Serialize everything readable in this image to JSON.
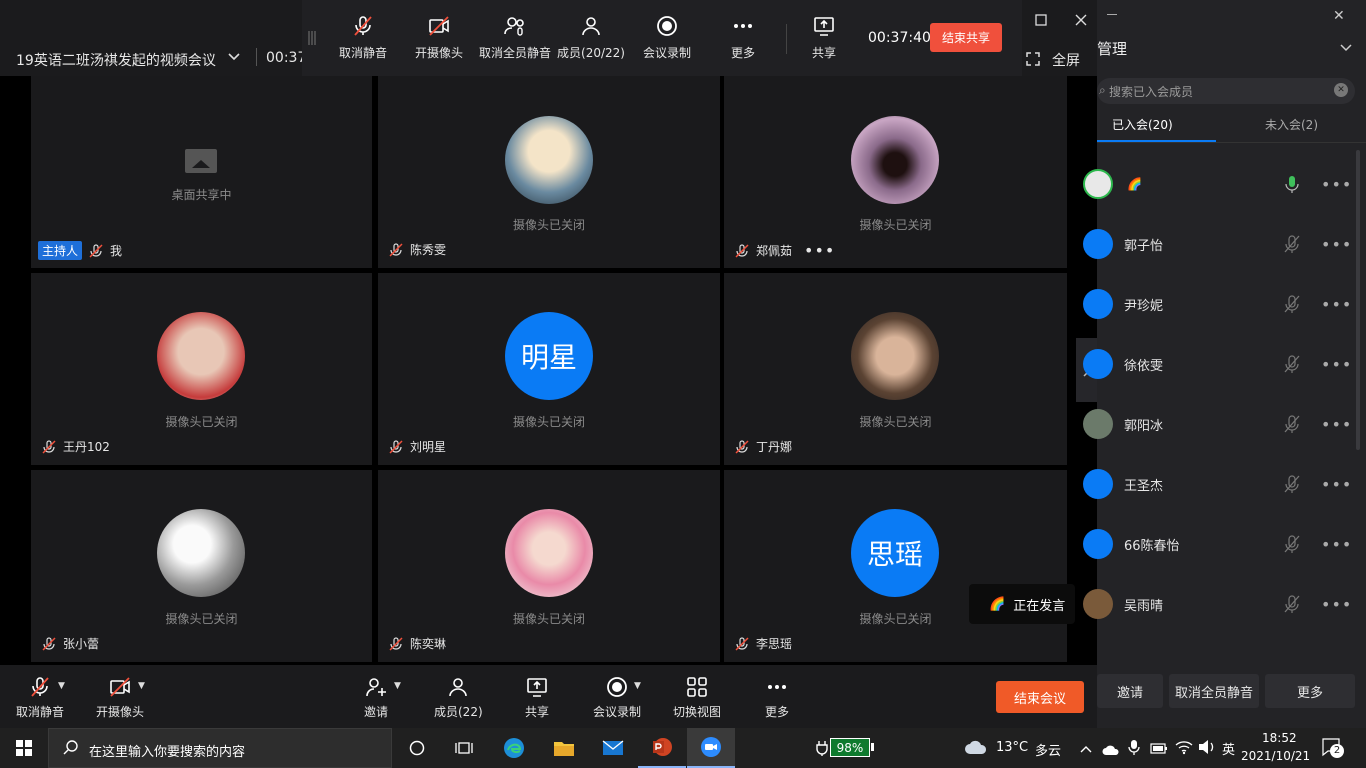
{
  "meeting": {
    "title": "19英语二班汤祺发起的视频会议",
    "elapsed_partial": "00:37.",
    "fullscreen_label": "全屏"
  },
  "top_toolbar": {
    "unmute": "取消静音",
    "camera_on": "开摄像头",
    "unmute_all": "取消全员静音",
    "members": "成员(20/22)",
    "record": "会议录制",
    "more": "更多",
    "share": "共享",
    "timer": "00:37:40",
    "end_share": "结束共享"
  },
  "tiles": [
    {
      "name": "我",
      "host": "主持人",
      "status": "桌面共享中"
    },
    {
      "name": "陈秀雯",
      "status": "摄像头已关闭"
    },
    {
      "name": "郑佩茹",
      "status": "摄像头已关闭"
    },
    {
      "name": "王丹102",
      "status": "摄像头已关闭"
    },
    {
      "name": "刘明星",
      "status": "摄像头已关闭",
      "avatar_text": "明星"
    },
    {
      "name": "丁丹娜",
      "status": "摄像头已关闭"
    },
    {
      "name": "张小蕾",
      "status": "摄像头已关闭"
    },
    {
      "name": "陈奕琳",
      "status": "摄像头已关闭"
    },
    {
      "name": "李思瑶",
      "status": "摄像头已关闭",
      "avatar_text": "思瑶"
    }
  ],
  "speaking_toast": "正在发言",
  "bottom_toolbar": {
    "unmute": "取消静音",
    "camera_on": "开摄像头",
    "invite": "邀请",
    "members": "成员(22)",
    "share": "共享",
    "record": "会议录制",
    "switch_view": "切换视图",
    "more": "更多",
    "end_meeting": "结束会议"
  },
  "side_panel": {
    "title": "管理",
    "search_placeholder": "搜索已入会成员",
    "tab_joined": "已入会(20)",
    "tab_not_joined": "未入会(2)",
    "members": [
      {
        "name": "🌈",
        "mic": "on"
      },
      {
        "name": "郭子怡",
        "mic": "off"
      },
      {
        "name": "尹珍妮",
        "mic": "off"
      },
      {
        "name": "徐依雯",
        "mic": "off"
      },
      {
        "name": "郭阳冰",
        "mic": "off"
      },
      {
        "name": "王圣杰",
        "mic": "off"
      },
      {
        "name": "66陈春怡",
        "mic": "off"
      },
      {
        "name": "吴雨晴",
        "mic": "off"
      }
    ],
    "invite": "邀请",
    "unmute_all": "取消全员静音",
    "more": "更多"
  },
  "taskbar": {
    "search_placeholder": "在这里输入你要搜索的内容",
    "battery": "98%",
    "weather_temp": "13°C",
    "weather_desc": "多云",
    "ime": "英",
    "time": "18:52",
    "date": "2021/10/21",
    "notifications": "2"
  }
}
